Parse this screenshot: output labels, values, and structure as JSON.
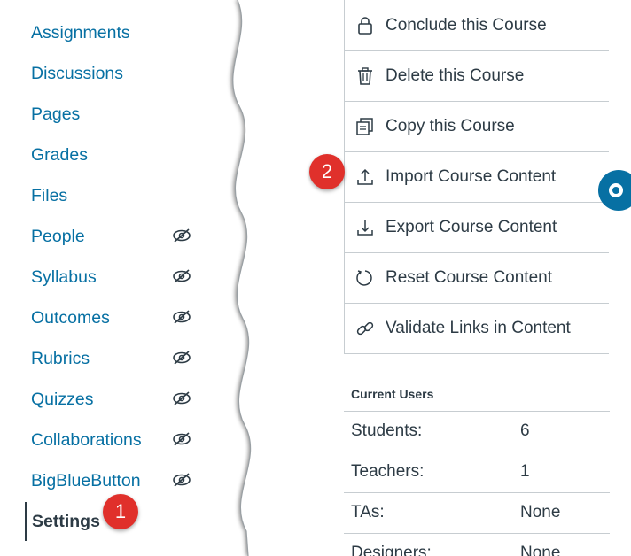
{
  "nav": {
    "items": [
      {
        "label": "Assignments",
        "hidden": false
      },
      {
        "label": "Discussions",
        "hidden": false
      },
      {
        "label": "Pages",
        "hidden": false
      },
      {
        "label": "Grades",
        "hidden": false
      },
      {
        "label": "Files",
        "hidden": false
      },
      {
        "label": "People",
        "hidden": true
      },
      {
        "label": "Syllabus",
        "hidden": true
      },
      {
        "label": "Outcomes",
        "hidden": true
      },
      {
        "label": "Rubrics",
        "hidden": true
      },
      {
        "label": "Quizzes",
        "hidden": true
      },
      {
        "label": "Collaborations",
        "hidden": true
      },
      {
        "label": "BigBlueButton",
        "hidden": true
      }
    ],
    "active": "Settings"
  },
  "actions": [
    {
      "label": "Conclude this Course",
      "icon": "lock-icon"
    },
    {
      "label": "Delete this Course",
      "icon": "trash-icon"
    },
    {
      "label": "Copy this Course",
      "icon": "copy-icon"
    },
    {
      "label": "Import Course Content",
      "icon": "upload-icon"
    },
    {
      "label": "Export Course Content",
      "icon": "download-icon"
    },
    {
      "label": "Reset Course Content",
      "icon": "reset-icon"
    },
    {
      "label": "Validate Links in Content",
      "icon": "link-icon"
    }
  ],
  "current_users": {
    "title": "Current Users",
    "rows": [
      {
        "role": "Students:",
        "count": "6"
      },
      {
        "role": "Teachers:",
        "count": "1"
      },
      {
        "role": "TAs:",
        "count": "None"
      },
      {
        "role": "Designers:",
        "count": "None"
      }
    ]
  },
  "callouts": {
    "one": "1",
    "two": "2"
  },
  "colors": {
    "link": "#0770a3",
    "text": "#2d3b45",
    "callout": "#e0302b",
    "border": "#c7cdd1"
  }
}
